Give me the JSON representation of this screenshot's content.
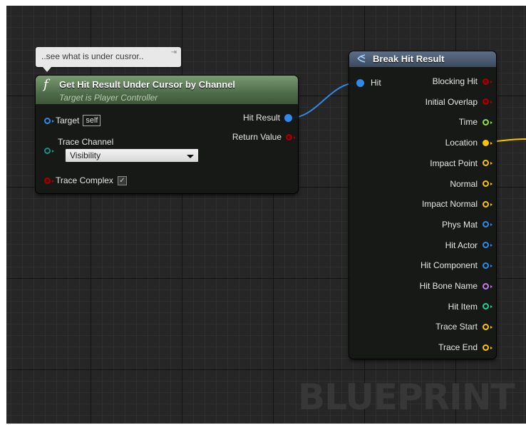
{
  "comment": {
    "text": "..see what is under cusror.."
  },
  "func_node": {
    "title": "Get Hit Result Under Cursor by Channel",
    "subtitle": "Target is Player Controller",
    "icon": "function-icon",
    "inputs": {
      "target": {
        "label": "Target",
        "value": "self"
      },
      "trace_channel": {
        "label": "Trace Channel",
        "selected": "Visibility"
      },
      "trace_complex": {
        "label": "Trace Complex",
        "checked": true
      }
    },
    "outputs": {
      "hit_result": "Hit Result",
      "return_value": "Return Value"
    }
  },
  "break_node": {
    "title": "Break Hit Result",
    "input": "Hit",
    "outputs": [
      {
        "label": "Blocking Hit",
        "color": "#a80000"
      },
      {
        "label": "Initial Overlap",
        "color": "#a80000"
      },
      {
        "label": "Time",
        "color": "#8ee24a"
      },
      {
        "label": "Location",
        "color": "#f7c600"
      },
      {
        "label": "Impact Point",
        "color": "#f7c600"
      },
      {
        "label": "Normal",
        "color": "#f7c600"
      },
      {
        "label": "Impact Normal",
        "color": "#f7c600"
      },
      {
        "label": "Phys Mat",
        "color": "#2f8ae8"
      },
      {
        "label": "Hit Actor",
        "color": "#2f8ae8"
      },
      {
        "label": "Hit Component",
        "color": "#2f8ae8"
      },
      {
        "label": "Hit Bone Name",
        "color": "#c07ae8"
      },
      {
        "label": "Hit Item",
        "color": "#1fd39a"
      },
      {
        "label": "Trace Start",
        "color": "#f7c600"
      },
      {
        "label": "Trace End",
        "color": "#f7c600"
      }
    ]
  },
  "colors": {
    "struct_pin": "#2f8ae8",
    "exec_red": "#a80000",
    "channel_teal": "#1a8f84",
    "vector_yellow": "#f7c600"
  },
  "watermark": "BLUEPRINT"
}
